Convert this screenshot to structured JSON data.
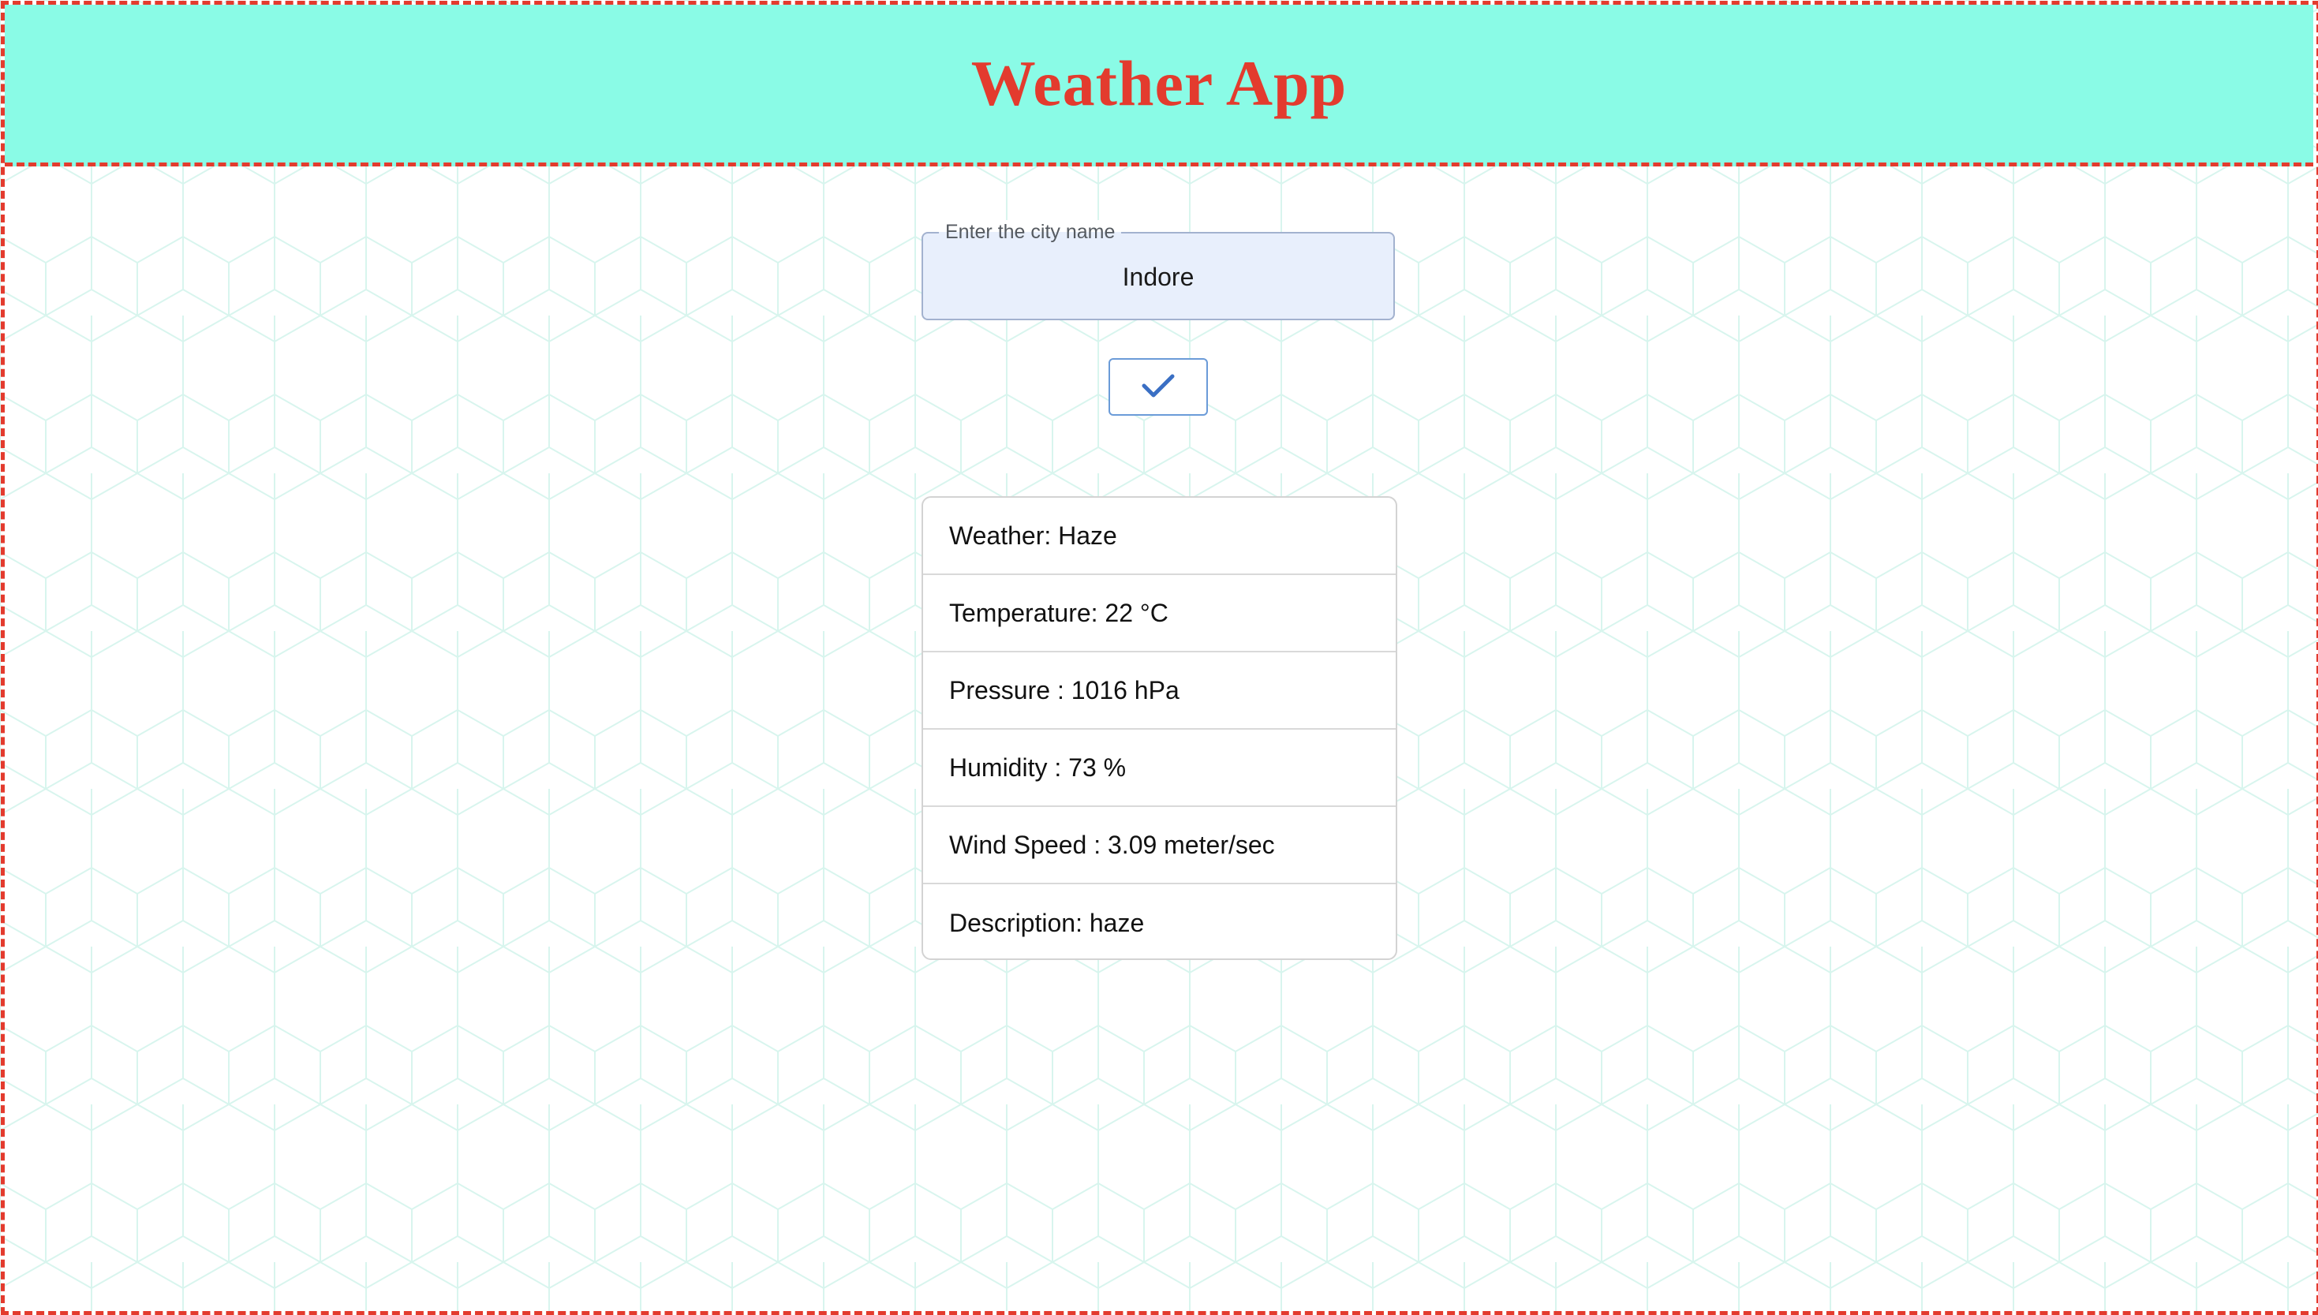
{
  "header": {
    "title": "Weather App"
  },
  "search": {
    "label": "Enter the city name",
    "value": "Indore"
  },
  "submit": {
    "icon": "checkmark-icon"
  },
  "results": [
    {
      "label": "Weather",
      "separator": ": ",
      "value": "Haze"
    },
    {
      "label": "Temperature",
      "separator": ": ",
      "value": "22 °C"
    },
    {
      "label": "Pressure",
      "separator": " : ",
      "value": "1016 hPa"
    },
    {
      "label": "Humidity",
      "separator": " : ",
      "value": "73 %"
    },
    {
      "label": "Wind Speed",
      "separator": " : ",
      "value": "3.09 meter/sec"
    },
    {
      "label": "Description",
      "separator": ": ",
      "value": "haze"
    }
  ],
  "colors": {
    "header_bg": "#8afbe6",
    "accent": "#e33b2e",
    "input_bg": "#e8effc",
    "button_border": "#6b9bd8",
    "hex_pattern": "#d8f5ee"
  }
}
